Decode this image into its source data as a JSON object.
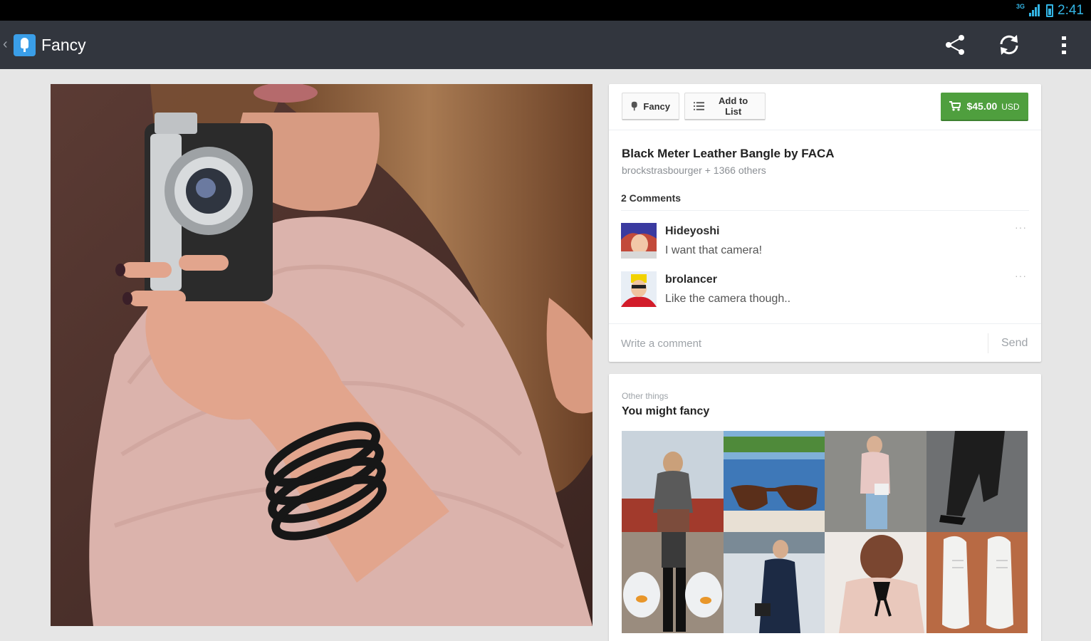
{
  "status_bar": {
    "network": "3G",
    "time": "2:41"
  },
  "action_bar": {
    "title": "Fancy",
    "icons": [
      "share-icon",
      "refresh-icon",
      "overflow-menu-icon"
    ]
  },
  "product": {
    "image_alt": "Woman holding a vintage camera wearing black leather bangle",
    "buttons": {
      "fancy_label": "Fancy",
      "add_to_list_label": "Add to List",
      "price": "$45.00",
      "currency": "USD"
    },
    "title": "Black Meter Leather Bangle by FACA",
    "fancied_by": "brockstrasbourger + 1366 others"
  },
  "comments": {
    "header": "2 Comments",
    "items": [
      {
        "user": "Hideyoshi",
        "text": "I want that camera!"
      },
      {
        "user": "brolancer",
        "text": "Like the camera though.."
      }
    ],
    "input_placeholder": "Write a comment",
    "send_label": "Send"
  },
  "related": {
    "kicker": "Other things",
    "title": "You might fancy",
    "thumbnails": [
      "Woman in scarf sitting on railing",
      "Tortoiseshell sunglasses by water",
      "Woman with quilted bag against wall",
      "Black trousers and heels",
      "Person holding goldfish bags",
      "Woman in navy dress with camera",
      "Blouse with black bow on back",
      "White canvas sneakers"
    ]
  },
  "colors": {
    "action_bar": "#32363e",
    "accent_blue": "#33b5e5",
    "price_green": "#4f9f3e",
    "background": "#e6e6e6"
  }
}
